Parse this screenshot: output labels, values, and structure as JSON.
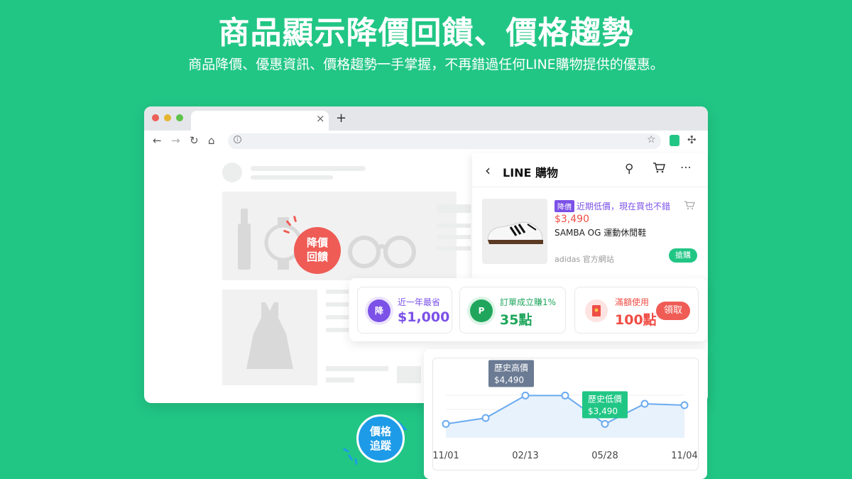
{
  "headline": "商品顯示降價回饋、價格趨勢",
  "subline": "商品降價、優惠資訊、價格趨勢一手掌握，不再錯過任何LINE購物提供的優惠。",
  "browser": {
    "tab_close": "×",
    "tab_new": "+",
    "nav": {
      "back": "←",
      "forward": "→",
      "reload": "↻",
      "home": "⌂"
    },
    "star": "☆"
  },
  "badges": {
    "price_drop_line1": "降價",
    "price_drop_line2": "回饋",
    "price_track_line1": "價格",
    "price_track_line2": "追蹤"
  },
  "panel": {
    "title": "LINE 購物",
    "product": {
      "tag": "降價",
      "tag_text": "近期低價，現在買也不錯",
      "price": "$3,490",
      "name": "SAMBA OG 運動休閒鞋",
      "shop": "adidas 官方網站",
      "buy_label": "搶購"
    }
  },
  "benefits": [
    {
      "icon": "降",
      "label": "近一年最省",
      "value": "$1,000",
      "color": "#7b51e7"
    },
    {
      "icon": "P",
      "label": "訂單成立賺1%",
      "value": "35點",
      "color": "#1fa65c"
    },
    {
      "icon": "",
      "label": "滿額使用",
      "value": "100點",
      "color": "#ef4d45",
      "action": "領取"
    }
  ],
  "chart_data": {
    "type": "line",
    "x": [
      "11/01",
      "",
      "02/13",
      "",
      "05/28",
      "",
      "11/04"
    ],
    "tick_labels": [
      "11/01",
      "02/13",
      "05/28",
      "11/04"
    ],
    "series": [
      {
        "values": [
          3490,
          3700,
          4490,
          4490,
          3490,
          4200,
          4150
        ]
      }
    ],
    "annotations": [
      {
        "label": "歷史高價",
        "value": "$4,490",
        "at_index": 2
      },
      {
        "label": "歷史低價",
        "value": "$3,490",
        "at_index": 4
      }
    ],
    "ylim": [
      3000,
      5000
    ],
    "grid": true,
    "colors": {
      "line": "#6aaaf0",
      "fill": "#e8f2fc",
      "high_box": "#6b7b93",
      "low_box": "#21c685"
    }
  }
}
